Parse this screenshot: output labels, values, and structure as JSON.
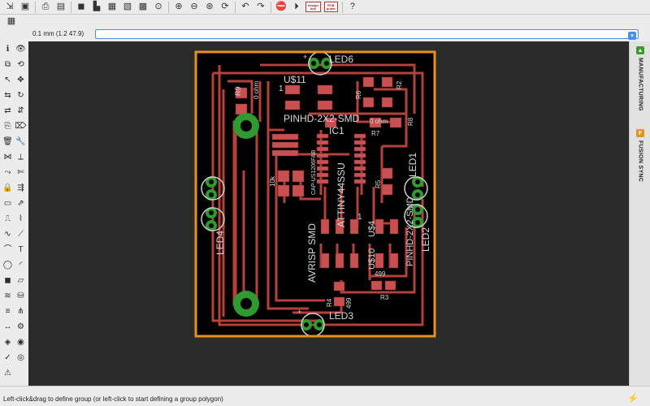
{
  "toolbar": {
    "buttons": [
      {
        "name": "open-icon",
        "glyph": "⇲"
      },
      {
        "name": "save-icon",
        "glyph": "▣"
      },
      {
        "name": "print-icon",
        "glyph": "⎙"
      },
      {
        "name": "cam-icon",
        "glyph": "▤"
      },
      {
        "name": "board-icon",
        "glyph": "◼"
      },
      {
        "name": "fab-icon",
        "glyph": "▙"
      },
      {
        "name": "ulp-icon",
        "glyph": "▦"
      },
      {
        "name": "scr-icon",
        "glyph": "▧"
      },
      {
        "name": "run-icon",
        "glyph": "▩"
      },
      {
        "name": "zoom-fit-icon",
        "glyph": "⊙"
      },
      {
        "name": "zoom-in-icon",
        "glyph": "⊕"
      },
      {
        "name": "zoom-out-icon",
        "glyph": "⊖"
      },
      {
        "name": "zoom-select-icon",
        "glyph": "⊛"
      },
      {
        "name": "zoom-redraw-icon",
        "glyph": "⟳"
      },
      {
        "name": "undo-icon",
        "glyph": "↶"
      },
      {
        "name": "redo-icon",
        "glyph": "↷"
      },
      {
        "name": "stop-icon",
        "glyph": "⛔"
      },
      {
        "name": "go-icon",
        "glyph": "⏵"
      },
      {
        "name": "help-icon",
        "glyph": "?"
      }
    ],
    "design_link": {
      "line1": "design",
      "line2": "link"
    },
    "pcb_quote": {
      "line1": "PCB",
      "line2": "quote"
    }
  },
  "toolbar2": {
    "grid_icon": "▦"
  },
  "command": {
    "coordinate": "0.1 mm (1.2 47.9)",
    "value": ""
  },
  "left_tools": [
    "ℹ",
    "👁",
    "⧉",
    "⟲",
    "↖",
    "✥",
    "⇆",
    "↻",
    "⇄",
    "⇵",
    "⎘",
    "⌦",
    "🗑",
    "🔧",
    "⋈",
    "⟂",
    "⤳",
    "✄",
    "🔒",
    "⇶",
    "▭",
    "⇗",
    "⎍",
    "⌇",
    "∿",
    "⟋",
    "⌒",
    "T",
    "◯",
    "◜",
    "◼",
    "▱",
    "≋",
    "⛁",
    "≡",
    "⋔",
    "↔",
    "⚙",
    "◈",
    "◉",
    "✓",
    "◎",
    "⚠"
  ],
  "right_panel": {
    "tabs": [
      {
        "label": "MANUFACTURING",
        "color": "#3c9a2e",
        "glyph": "▲"
      },
      {
        "label": "FUSION SYNC",
        "color": "#e8901a",
        "glyph": "F"
      }
    ]
  },
  "status": {
    "message": "Left-click&drag to define group (or left-click to start defining a group polygon)"
  },
  "board": {
    "outline_color": "#e8901a",
    "trace_color": "#b5413a",
    "pad_color": "#c85050",
    "via_color": "#2f9a2f",
    "labels": {
      "led6": "LED6",
      "u11": "U$11",
      "u1": "1",
      "pinhd_top": "PINHD-2X2-SMD",
      "ic1": "IC1",
      "attiny": "ATTINY44SSU",
      "cap": "CAP-US1206FAB",
      "k10": "10k",
      "r9": "R9",
      "r9v": "0 ohm",
      "r6": "R6",
      "r2": "R2",
      "r7": "R7",
      "r7v": "0 ohm",
      "r8": "R8",
      "r5": "R5",
      "r4": "R4",
      "r4v": "499",
      "r3": "R3",
      "r3v": "499",
      "led3": "LED3",
      "led4": "LED4",
      "led1": "LED1",
      "led2": "LED2",
      "avrisp": "AVRISP SMD",
      "u10": "U$10",
      "u4": "U$4",
      "pinhd_right": "PINHD-2X2-SMD",
      "one": "1",
      "zero": "0 ohm",
      "plus": "+"
    }
  }
}
